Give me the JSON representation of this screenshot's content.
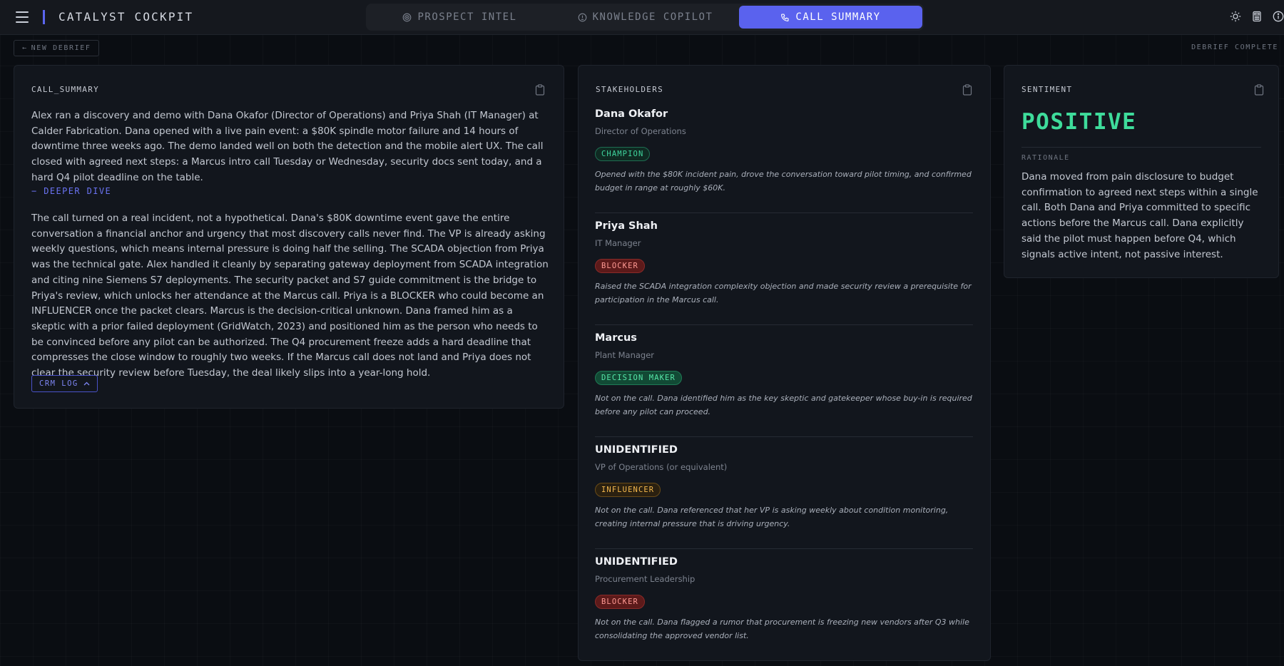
{
  "app": {
    "title": "CATALYST COCKPIT"
  },
  "tabs": [
    {
      "label": "PROSPECT INTEL",
      "icon": "target-icon",
      "active": false
    },
    {
      "label": "KNOWLEDGE COPILOT",
      "icon": "lightbulb-icon",
      "active": false
    },
    {
      "label": "CALL SUMMARY",
      "icon": "phone-icon",
      "active": true
    }
  ],
  "header_icons": [
    "sun-icon",
    "calculator-icon",
    "info-icon"
  ],
  "toolbar": {
    "new_debrief": "NEW DEBRIEF",
    "status": "DEBRIEF COMPLETE"
  },
  "summary": {
    "title": "CALL_SUMMARY",
    "paragraph1": "Alex ran a discovery and demo with Dana Okafor (Director of Operations) and Priya Shah (IT Manager) at Calder Fabrication. Dana opened with a live pain event: a $80K spindle motor failure and 14 hours of downtime three weeks ago. The demo landed well on both the detection and the mobile alert UX. The call closed with agreed next steps: a Marcus intro call Tuesday or Wednesday, security docs sent today, and a hard Q4 pilot deadline on the table.",
    "deeper_dive": "DEEPER DIVE",
    "paragraph2": "The call turned on a real incident, not a hypothetical. Dana's $80K downtime event gave the entire conversation a financial anchor and urgency that most discovery calls never find. The VP is already asking weekly questions, which means internal pressure is doing half the selling. The SCADA objection from Priya was the technical gate. Alex handled it cleanly by separating gateway deployment from SCADA integration and citing nine Siemens S7 deployments. The security packet and S7 guide commitment is the bridge to Priya's review, which unlocks her attendance at the Marcus call. Priya is a BLOCKER who could become an INFLUENCER once the packet clears. Marcus is the decision-critical unknown. Dana framed him as a skeptic with a prior failed deployment (GridWatch, 2023) and positioned him as the person who needs to be convinced before any pilot can be authorized. The Q4 procurement freeze adds a hard deadline that compresses the close window to roughly two weeks. If the Marcus call does not land and Priya does not clear the security review before Tuesday, the deal likely slips into a year-long hold.",
    "crm_log": "CRM LOG"
  },
  "stakeholders": {
    "title": "STAKEHOLDERS",
    "items": [
      {
        "name": "Dana Okafor",
        "role": "Director of Operations",
        "badge": "CHAMPION",
        "badge_type": "champion",
        "note": "Opened with the $80K incident pain, drove the conversation toward pilot timing, and confirmed budget in range at roughly $60K."
      },
      {
        "name": "Priya Shah",
        "role": "IT Manager",
        "badge": "BLOCKER",
        "badge_type": "blocker",
        "note": "Raised the SCADA integration complexity objection and made security review a prerequisite for participation in the Marcus call."
      },
      {
        "name": "Marcus",
        "role": "Plant Manager",
        "badge": "DECISION MAKER",
        "badge_type": "decision",
        "note": "Not on the call. Dana identified him as the key skeptic and gatekeeper whose buy-in is required before any pilot can proceed."
      },
      {
        "name": "UNIDENTIFIED",
        "role": "VP of Operations (or equivalent)",
        "badge": "INFLUENCER",
        "badge_type": "influencer",
        "note": "Not on the call. Dana referenced that her VP is asking weekly about condition monitoring, creating internal pressure that is driving urgency."
      },
      {
        "name": "UNIDENTIFIED",
        "role": "Procurement Leadership",
        "badge": "BLOCKER",
        "badge_type": "blocker",
        "note": "Not on the call. Dana flagged a rumor that procurement is freezing new vendors after Q3 while consolidating the approved vendor list."
      }
    ]
  },
  "sentiment": {
    "title": "SENTIMENT",
    "value": "POSITIVE",
    "value_color": "#3edc9b",
    "rationale_label": "RATIONALE",
    "rationale": "Dana moved from pain disclosure to budget confirmation to agreed next steps within a single call. Both Dana and Priya committed to specific actions before the Marcus call. Dana explicitly said the pilot must happen before Q4, which signals active intent, not passive interest."
  },
  "colors": {
    "accent": "#5a62ee",
    "champion": "#3fd49d",
    "blocker": "#ff9a94",
    "decision_maker": "#56e7a8",
    "influencer": "#f5b94e"
  }
}
